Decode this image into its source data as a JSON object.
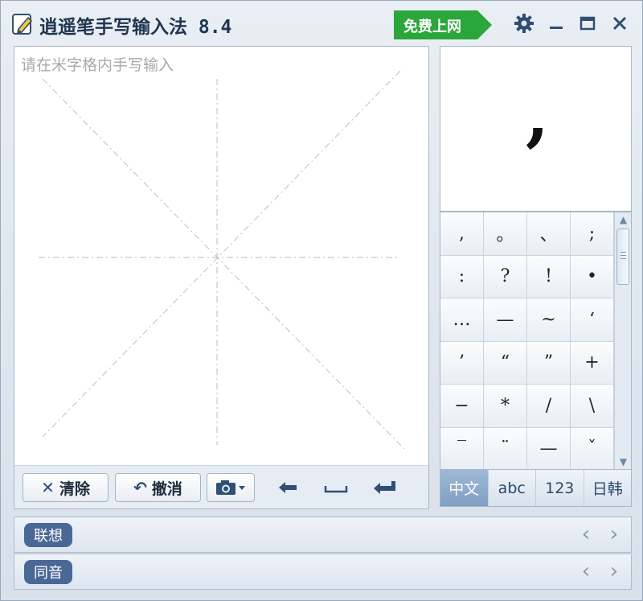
{
  "app": {
    "title": "逍遥笔手写输入法 8.4",
    "net_button": "免费上网"
  },
  "colors": {
    "accent": "#4a6896",
    "net_green": "#2aa63a",
    "tab_active": "#8aa8cb"
  },
  "titlebar_icons": [
    "gear-icon",
    "minimize-icon",
    "maximize-icon",
    "close-icon"
  ],
  "write": {
    "hint": "请在米字格内手写输入",
    "clear_label": "清除",
    "undo_label": "撤消"
  },
  "preview": {
    "char": ","
  },
  "symbols": [
    ",",
    "。",
    "、",
    ";",
    ":",
    "?",
    "!",
    "•",
    "…",
    "—",
    "~",
    "‘",
    "’",
    "“",
    "”",
    "+",
    "−",
    "*",
    "/",
    "\\",
    "‾",
    "¨",
    "—",
    "ˇ"
  ],
  "lang_tabs": [
    {
      "label": "中文",
      "active": true
    },
    {
      "label": "abc",
      "active": false
    },
    {
      "label": "123",
      "active": false
    },
    {
      "label": "日韩",
      "active": false
    }
  ],
  "rows": [
    {
      "label": "联想"
    },
    {
      "label": "同音"
    }
  ]
}
